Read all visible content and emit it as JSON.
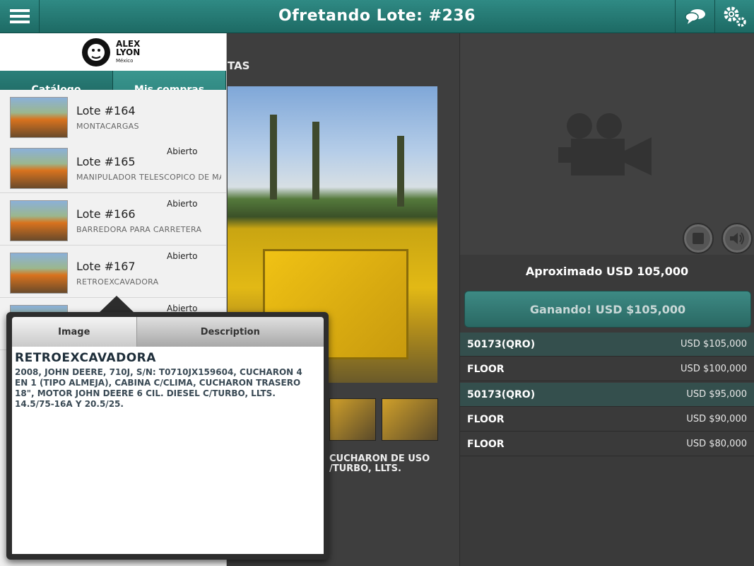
{
  "header": {
    "title": "Ofretando Lote: #236",
    "menu_icon": "hamburger-menu-icon",
    "chat_icon": "chat-bubbles-icon",
    "settings_icon": "gears-icon"
  },
  "sidebar": {
    "logo_text": "ALEX LYON",
    "logo_sub": "México",
    "tabs": [
      {
        "label": "Catálogo"
      },
      {
        "label": "Mis compras"
      }
    ],
    "lots": [
      {
        "name": "Lote #164",
        "desc": "MONTACARGAS",
        "status": ""
      },
      {
        "name": "Lote #165",
        "desc": "MANIPULADOR TELESCOPICO DE MATERIALES",
        "status": "Abierto"
      },
      {
        "name": "Lote #166",
        "desc": "BARREDORA PARA CARRETERA",
        "status": "Abierto"
      },
      {
        "name": "Lote #167",
        "desc": "RETROEXCAVADORA",
        "status": "Abierto"
      },
      {
        "name": "",
        "desc": "",
        "status": "Abierto"
      }
    ]
  },
  "center": {
    "header_tail": "TAS",
    "desc_tail_1": "CUCHARON DE USO",
    "desc_tail_2": "/TURBO, LLTS."
  },
  "popover": {
    "tabs": [
      {
        "label": "Image"
      },
      {
        "label": "Description"
      }
    ],
    "title": "RETROEXCAVADORA",
    "text": "2008, JOHN DEERE, 710J, S/N: T0710JX159604, CUCHARON 4 EN 1 (TIPO ALMEJA), CABINA C/CLIMA, CUCHARON TRASERO 18\", MOTOR JOHN DEERE 6 CIL. DIESEL C/TURBO, LLTS. 14.5/75-16A Y 20.5/25."
  },
  "bidding": {
    "approx": "Aproximado USD 105,000",
    "winning_label": "Ganando! USD $105,000",
    "rows": [
      {
        "bidder": "50173(QRO)",
        "amount": "USD $105,000",
        "highlight": true
      },
      {
        "bidder": "FLOOR",
        "amount": "USD $100,000",
        "highlight": false
      },
      {
        "bidder": "50173(QRO)",
        "amount": "USD $95,000",
        "highlight": true
      },
      {
        "bidder": "FLOOR",
        "amount": "USD $90,000",
        "highlight": false
      },
      {
        "bidder": "FLOOR",
        "amount": "USD $80,000",
        "highlight": false
      }
    ]
  },
  "colors": {
    "accent": "#1d6a64",
    "bid_highlight": "#344f4d"
  }
}
